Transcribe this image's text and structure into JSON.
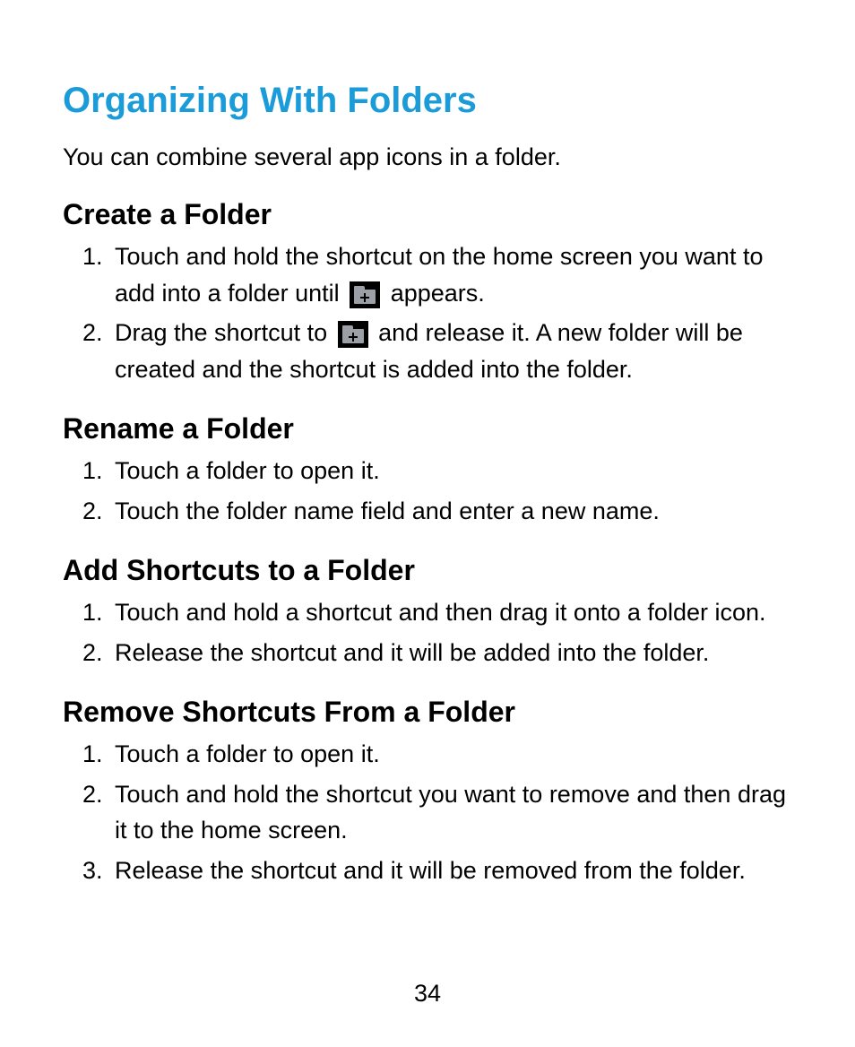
{
  "title": "Organizing With Folders",
  "intro": "You can combine several app icons in a folder.",
  "sections": {
    "create": {
      "heading": "Create a Folder",
      "step1_a": "Touch and hold the shortcut on the home screen you want to add into a folder until ",
      "step1_b": " appears.",
      "step2_a": "Drag the shortcut to ",
      "step2_b": " and release it. A new folder will be created and the shortcut is added into the folder."
    },
    "rename": {
      "heading": "Rename a Folder",
      "step1": "Touch a folder to open it.",
      "step2": "Touch the folder name field and enter a new name."
    },
    "add": {
      "heading": "Add Shortcuts to a Folder",
      "step1": "Touch and hold a shortcut and then drag it onto a folder icon.",
      "step2": "Release the shortcut and it will be added into the folder."
    },
    "remove": {
      "heading": "Remove Shortcuts From a Folder",
      "step1": "Touch a folder to open it.",
      "step2": "Touch and hold the shortcut you want to remove and then drag it to the home screen.",
      "step3": "Release the shortcut and it will be removed from the folder."
    }
  },
  "page_number": "34",
  "icons": {
    "folder_add": "folder-add-icon"
  }
}
